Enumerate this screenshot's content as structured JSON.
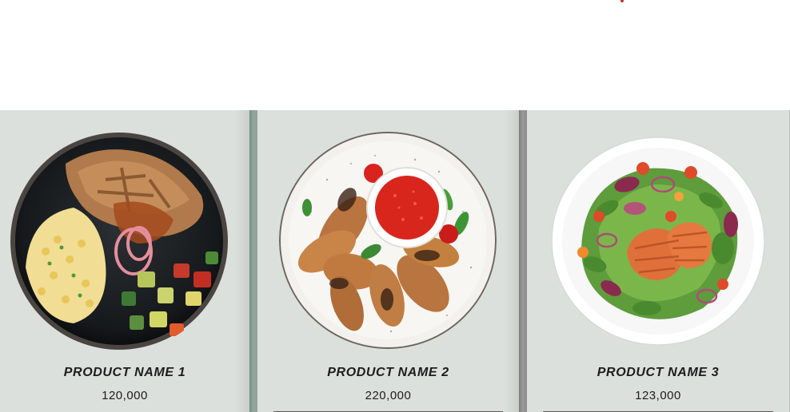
{
  "products": [
    {
      "name": "PRODUCT NAME 1",
      "price": "120,000"
    },
    {
      "name": "PRODUCT NAME 2",
      "price": "220,000"
    },
    {
      "name": "PRODUCT NAME 3",
      "price": "123,000"
    }
  ],
  "colors": {
    "card_background": "#dbe0dd",
    "text": "#1c1c1c",
    "accent_mark": "#c0392b"
  },
  "icons": [
    "rice-bowl-dish-image",
    "chicken-wings-dish-image",
    "salmon-salad-dish-image"
  ]
}
